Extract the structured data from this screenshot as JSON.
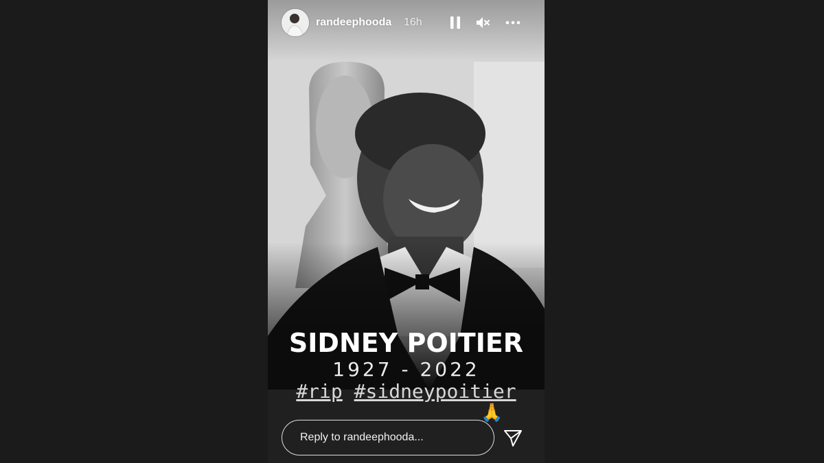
{
  "story": {
    "username": "randeephooda",
    "timestamp": "16h",
    "controls": {
      "pause_icon": "pause-icon",
      "mute_icon": "muted-speaker-icon",
      "more_icon": "more-horizontal-icon"
    },
    "content": {
      "title": "SIDNEY POITIER",
      "years": "1927 - 2022",
      "hashtags": [
        "#rip",
        "#sidneypoitier"
      ],
      "emoji": "🙏"
    },
    "reply": {
      "placeholder": "Reply to randeephooda...",
      "send_icon": "paper-plane-send-icon"
    }
  },
  "colors": {
    "page_background": "#1b1b1b",
    "story_background": "#1f1f1f",
    "text_primary": "#ffffff"
  }
}
